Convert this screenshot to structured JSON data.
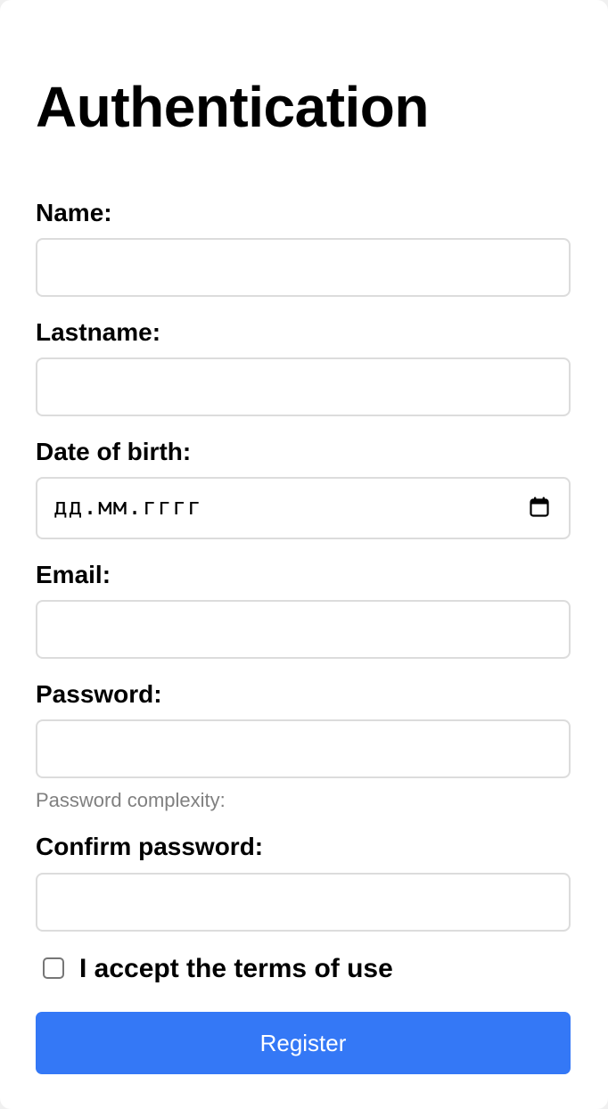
{
  "page_title": "Authentication",
  "fields": {
    "name": {
      "label": "Name:",
      "value": "",
      "placeholder": ""
    },
    "lastname": {
      "label": "Lastname:",
      "value": "",
      "placeholder": ""
    },
    "date_of_birth": {
      "label": "Date of birth:",
      "placeholder_format": "дд.мм.гггг",
      "icon": "calendar-icon"
    },
    "email": {
      "label": "Email:",
      "value": "",
      "placeholder": ""
    },
    "password": {
      "label": "Password:",
      "value": "",
      "placeholder": "",
      "hint": "Password complexity:"
    },
    "confirm_password": {
      "label": "Confirm password:",
      "value": "",
      "placeholder": ""
    }
  },
  "terms": {
    "label": "I accept the terms of use",
    "checked": false
  },
  "register_button": {
    "label": "Register",
    "color": "#3478f6"
  },
  "colors": {
    "background": "#ffffff",
    "input_border": "#dcdcdc",
    "hint_text": "#808080",
    "accent": "#3478f6"
  }
}
